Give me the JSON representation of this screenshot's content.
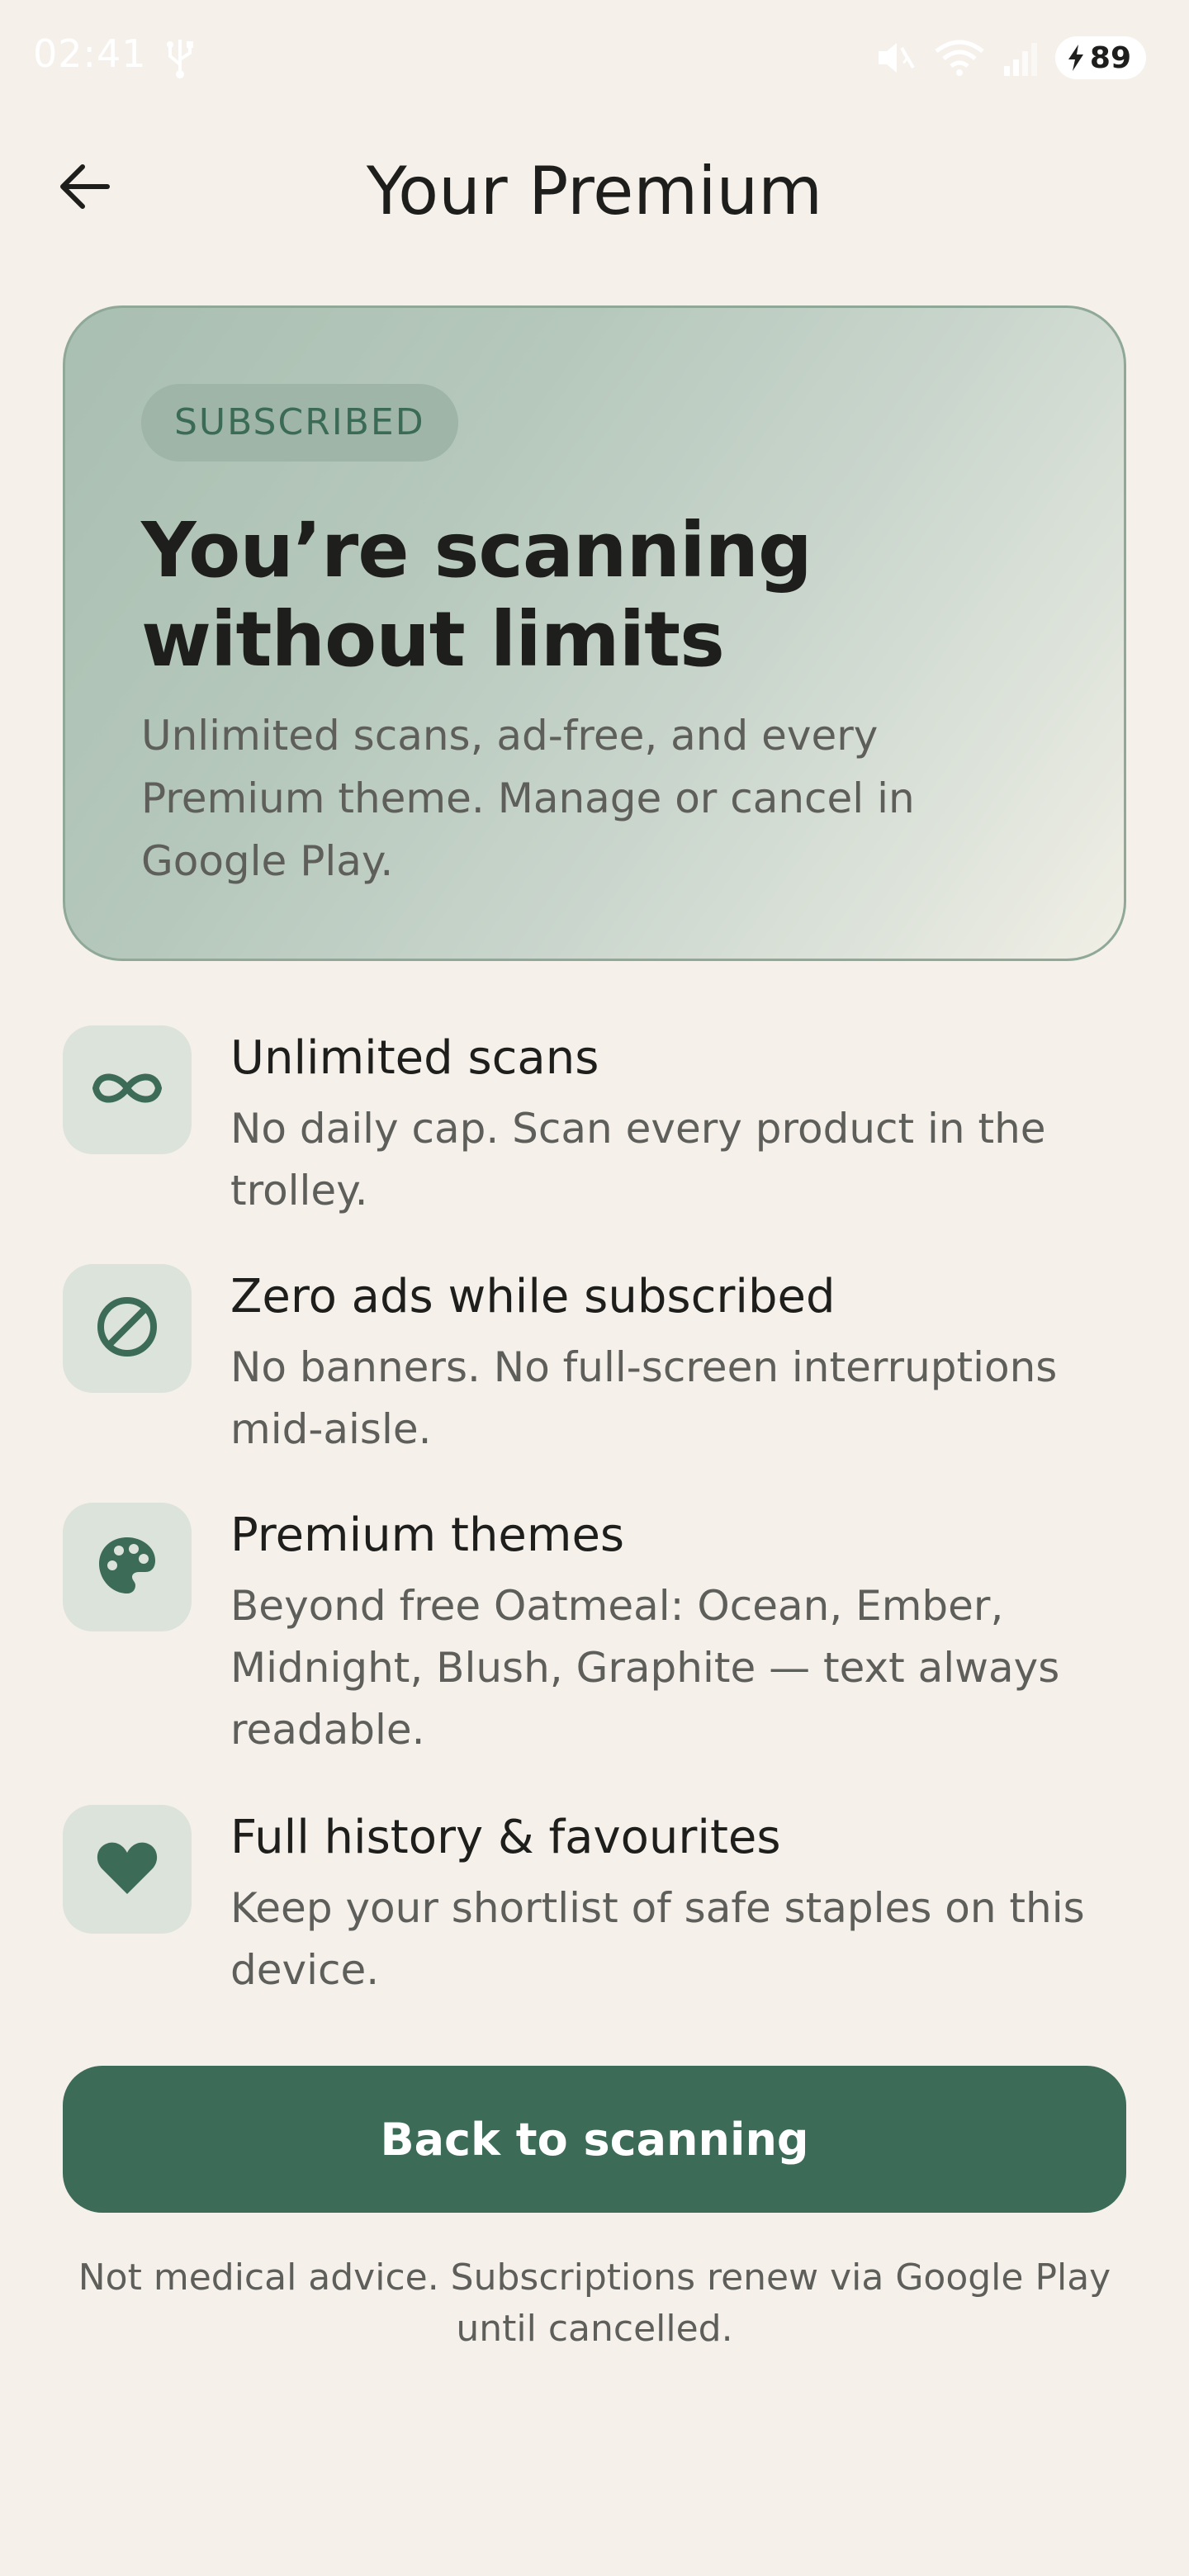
{
  "status_bar": {
    "time": "02:41",
    "battery_level": "89",
    "icons": [
      "usb-icon",
      "mute-icon",
      "wifi-icon",
      "signal-icon",
      "charging-bolt-icon"
    ]
  },
  "header": {
    "title": "Your Premium",
    "back_icon": "arrow-left-icon"
  },
  "hero": {
    "chip": "SUBSCRIBED",
    "heading": "You’re scanning without limits",
    "body": "Unlimited scans, ad-free, and every Premium theme. Manage or cancel in Google Play."
  },
  "features": [
    {
      "icon": "infinity-icon",
      "title": "Unlimited scans",
      "desc": "No daily cap. Scan every product in the trolley."
    },
    {
      "icon": "block-icon",
      "title": "Zero ads while subscribed",
      "desc": "No banners. No full-screen interruptions mid-aisle."
    },
    {
      "icon": "palette-icon",
      "title": "Premium themes",
      "desc": "Beyond free Oatmeal: Ocean, Ember, Midnight, Blush, Graphite — text always readable."
    },
    {
      "icon": "heart-icon",
      "title": "Full history & favourites",
      "desc": "Keep your shortlist of safe staples on this device."
    }
  ],
  "cta": {
    "label": "Back to scanning"
  },
  "footer": {
    "disclaimer": "Not medical advice. Subscriptions renew via Google Play until cancelled."
  },
  "colors": {
    "background": "#f5f1ea",
    "accent": "#3c6b57",
    "icon_tile": "#dce3da",
    "text_primary": "#1e1e1c",
    "text_secondary": "#5e5e5a"
  }
}
